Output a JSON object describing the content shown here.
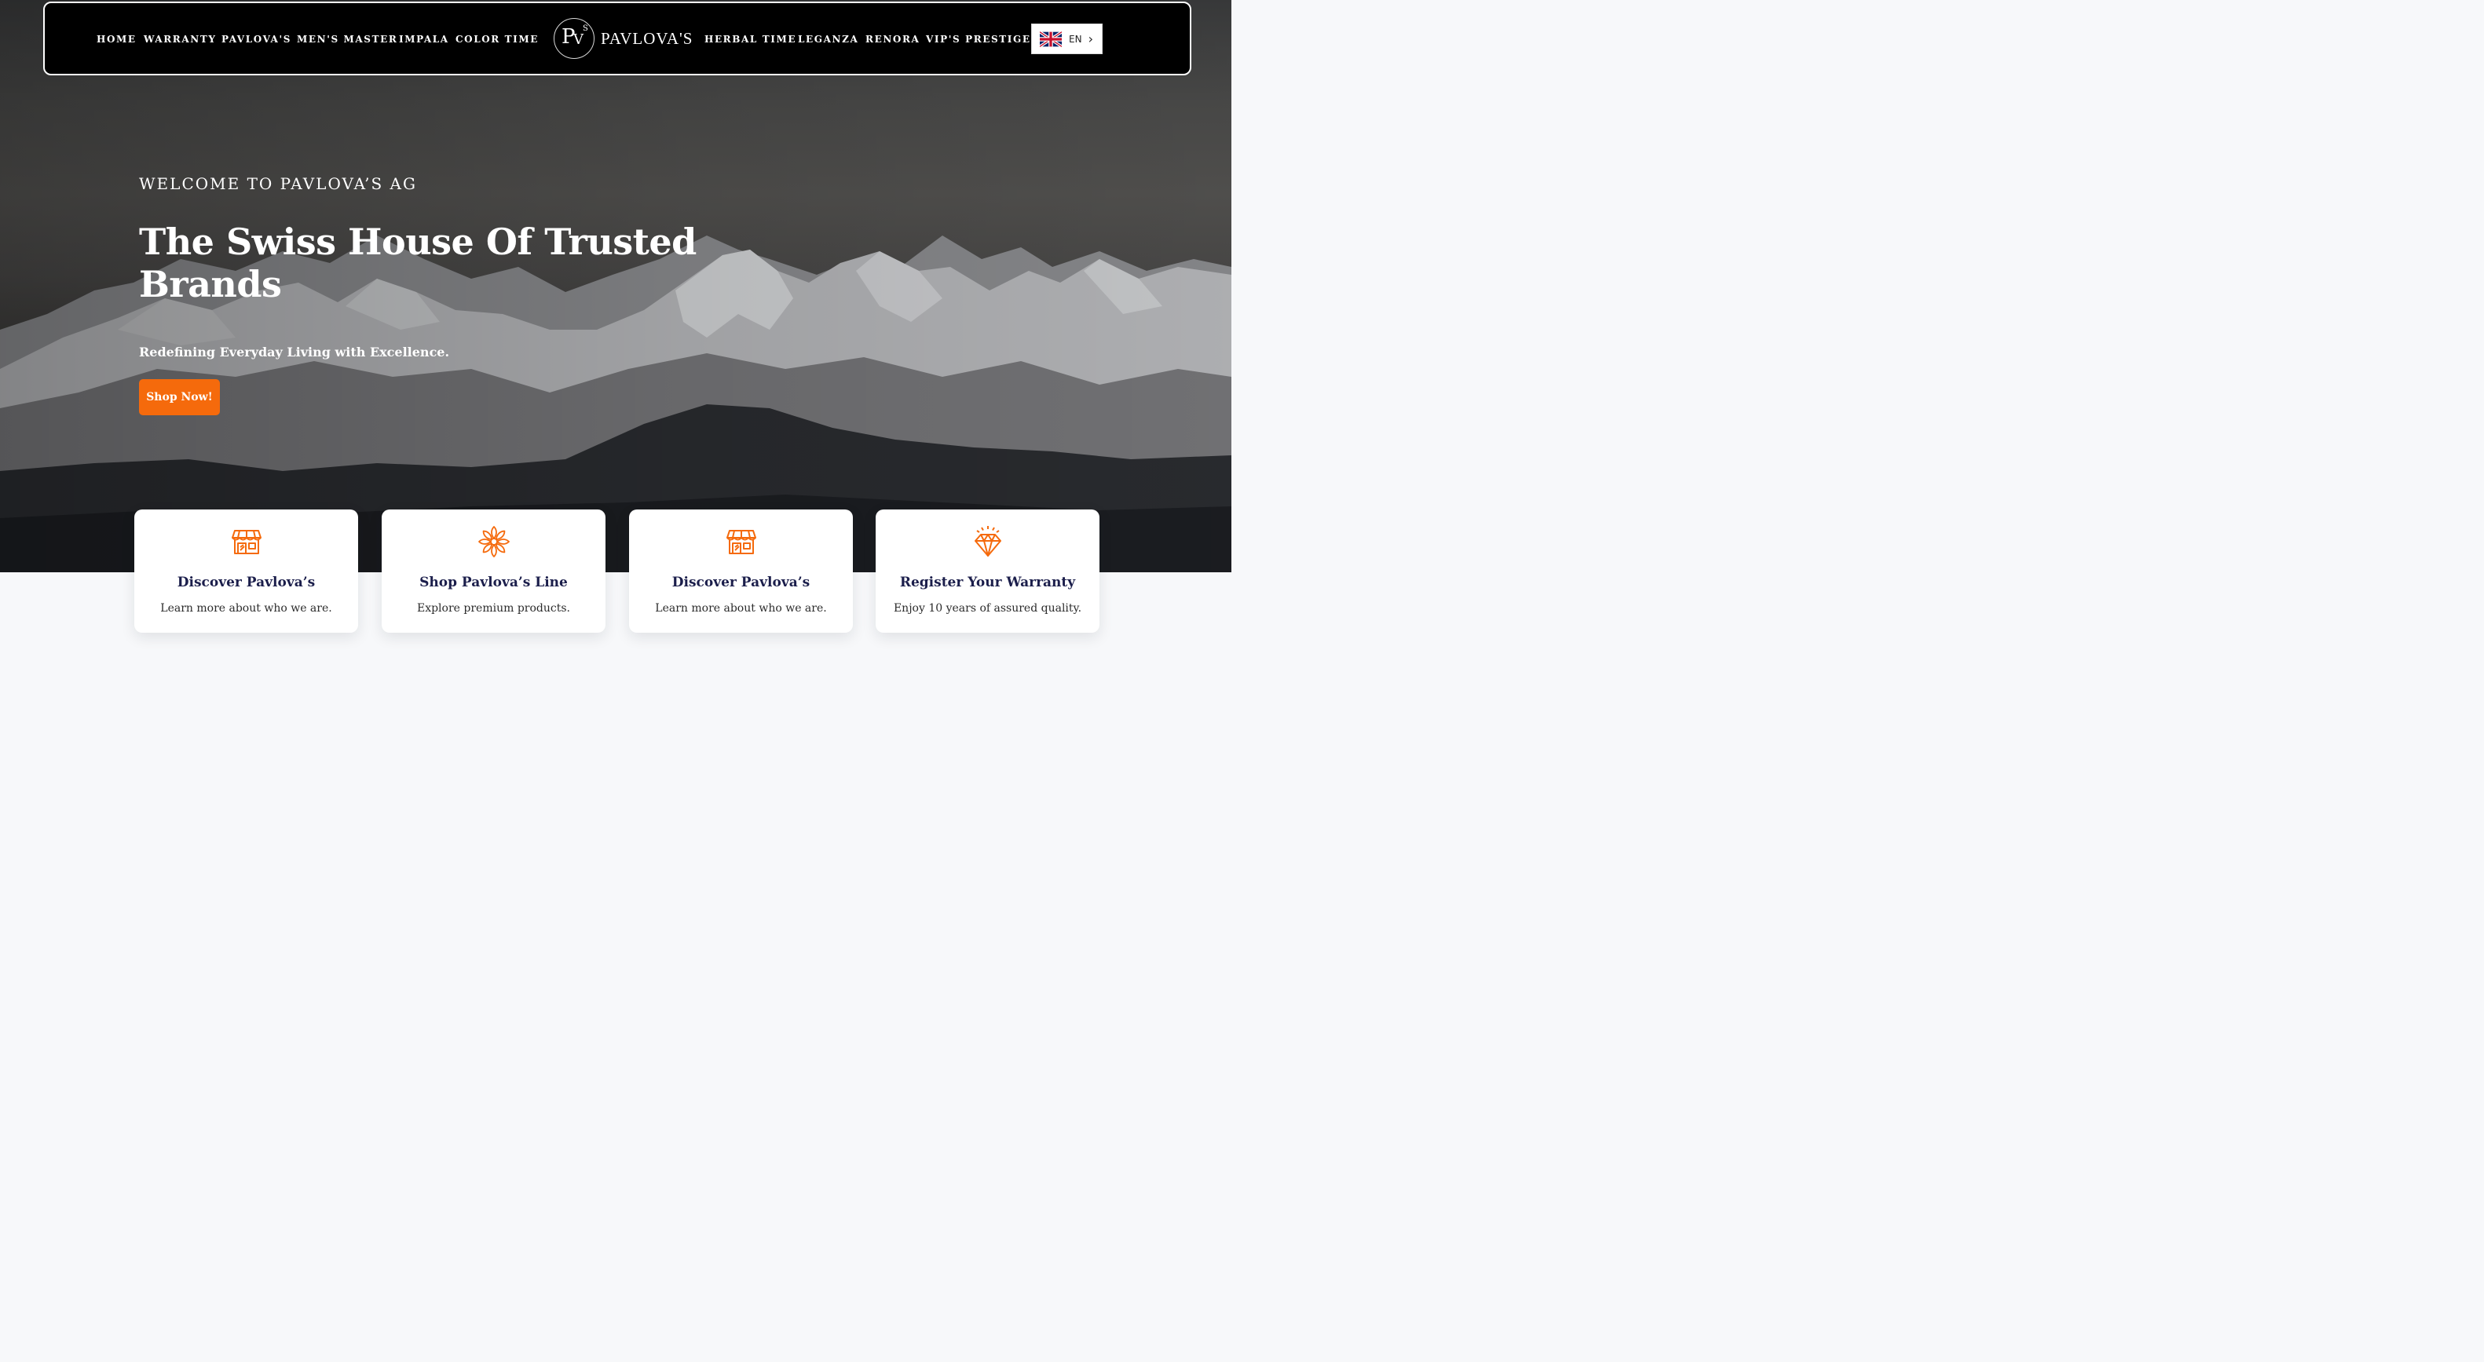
{
  "nav": {
    "left_links": [
      "HOME",
      "WARRANTY",
      "PAVLOVA'S",
      "MEN'S MASTER",
      "IMPALA",
      "COLOR TIME"
    ],
    "right_links": [
      "HERBAL TIME",
      "LEGANZA",
      "RENORA",
      "VIP'S PRESTIGE"
    ],
    "logo": {
      "text": "PAVLOVA'S",
      "monogram": "PVS"
    },
    "language": {
      "code": "EN",
      "flag_icon": "uk-flag-icon",
      "chevron_icon": "chevron-right-icon"
    }
  },
  "hero": {
    "eyebrow": "WELCOME TO PAVLOVA’S AG",
    "headline": "The Swiss House Of Trusted Brands",
    "subline": "Redefining Everyday Living with Excellence.",
    "cta_label": "Shop Now!"
  },
  "cards": [
    {
      "icon": "storefront-icon",
      "title": "Discover Pavlova’s",
      "desc": "Learn more about who we are."
    },
    {
      "icon": "flower-icon",
      "title": "Shop Pavlova’s Line",
      "desc": "Explore premium products."
    },
    {
      "icon": "storefront-icon",
      "title": "Discover Pavlova’s",
      "desc": "Learn more about who we are."
    },
    {
      "icon": "diamond-icon",
      "title": "Register Your Warranty",
      "desc": "Enjoy 10 years of assured quality."
    }
  ],
  "colors": {
    "accent": "#f56a0c",
    "nav_bg": "#000000",
    "card_title": "#1b1e4b",
    "page_bg": "#f7f8fa"
  }
}
